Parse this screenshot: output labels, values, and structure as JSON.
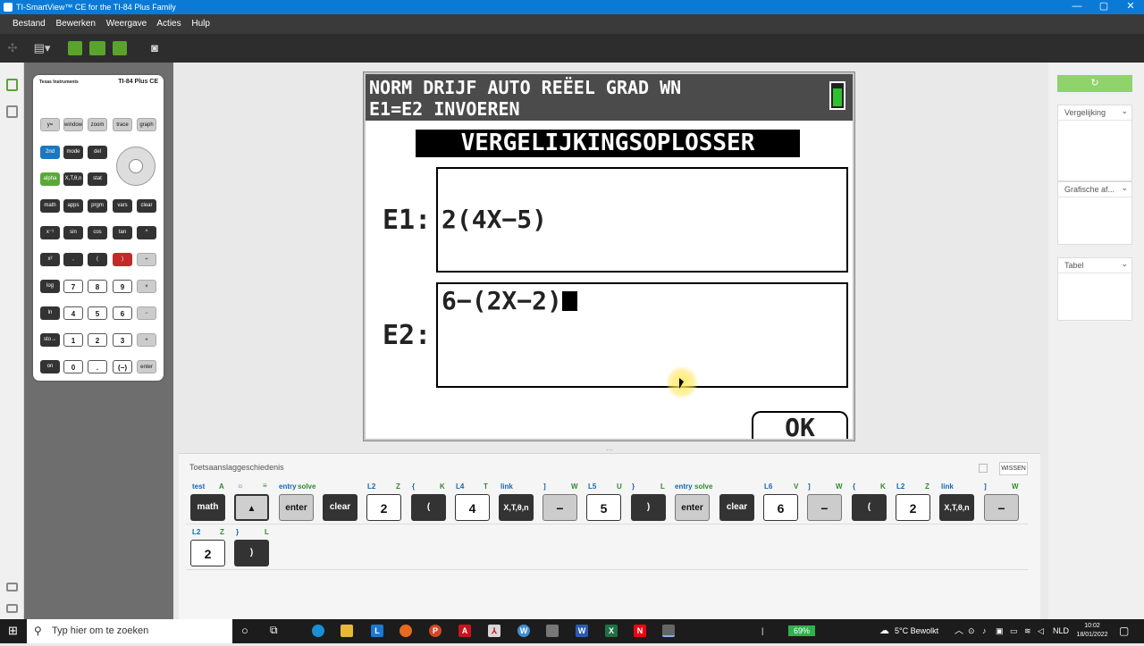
{
  "window": {
    "title": "TI-SmartView™ CE for the TI-84 Plus Family",
    "controls": [
      "—",
      "▢",
      "✕"
    ]
  },
  "menu": [
    "Bestand",
    "Bewerken",
    "Weergave",
    "Acties",
    "Hulp"
  ],
  "calculator": {
    "brand": "Texas Instruments",
    "model": "TI-84 Plus CE",
    "keys": {
      "y": "y=",
      "window": "window",
      "zoom": "zoom",
      "trace": "trace",
      "graph": "graph",
      "second": "2nd",
      "mode": "mode",
      "del": "del",
      "alpha": "alpha",
      "xt": "X,T,θ,n",
      "stat": "stat",
      "math": "math",
      "apps": "apps",
      "prgm": "prgm",
      "vars": "vars",
      "clear": "clear",
      "inv": "x⁻¹",
      "sin": "sin",
      "cos": "cos",
      "tan": "tan",
      "pow": "^",
      "sq": "x²",
      "comma": ",",
      "lp": "(",
      "rp": ")",
      "div": "÷",
      "log": "log",
      "k7": "7",
      "k8": "8",
      "k9": "9",
      "mul": "×",
      "ln": "ln",
      "k4": "4",
      "k5": "5",
      "k6": "6",
      "sub": "−",
      "sto": "sto→",
      "k1": "1",
      "k2": "2",
      "k3": "3",
      "add": "+",
      "on": "on",
      "k0": "0",
      "dot": ".",
      "neg": "(−)",
      "enter": "enter"
    }
  },
  "lcd": {
    "status_line1": "NORM DRIJF AUTO REËEL GRAD WN",
    "status_line2": "E1=E2 INVOEREN",
    "title": "VERGELIJKINGSOPLOSSER",
    "e1_label": "E1:",
    "e1_value": "2(4X−5)",
    "e2_label": "E2:",
    "e2_value": "6−(2X−2)",
    "ok": "OK"
  },
  "history": {
    "title": "Toetsaanslaggeschiedenis",
    "clear_label": "WISSEN",
    "row1": [
      {
        "top_left": "test",
        "top_right": "A",
        "label": "math"
      },
      {
        "top_left": "☼",
        "top_right": "≡",
        "label": "▲"
      },
      {
        "top_left": "entry",
        "top_right": "solve",
        "label": "enter"
      },
      {
        "top_left": "",
        "top_right": "",
        "label": "clear"
      },
      {
        "top_left": "L2",
        "top_right": "Z",
        "label": "2"
      },
      {
        "top_left": "{",
        "top_right": "K",
        "label": "("
      },
      {
        "top_left": "L4",
        "top_right": "T",
        "label": "4"
      },
      {
        "top_left": "link",
        "top_right": "",
        "label": "X,T,θ,n"
      },
      {
        "top_left": "]",
        "top_right": "W",
        "label": "−"
      },
      {
        "top_left": "L5",
        "top_right": "U",
        "label": "5"
      },
      {
        "top_left": "}",
        "top_right": "L",
        "label": ")"
      },
      {
        "top_left": "entry",
        "top_right": "solve",
        "label": "enter"
      },
      {
        "top_left": "",
        "top_right": "",
        "label": "clear"
      },
      {
        "top_left": "L6",
        "top_right": "V",
        "label": "6"
      },
      {
        "top_left": "]",
        "top_right": "W",
        "label": "−"
      },
      {
        "top_left": "{",
        "top_right": "K",
        "label": "("
      },
      {
        "top_left": "L2",
        "top_right": "Z",
        "label": "2"
      },
      {
        "top_left": "link",
        "top_right": "",
        "label": "X,T,θ,n"
      },
      {
        "top_left": "]",
        "top_right": "W",
        "label": "−"
      }
    ],
    "row2": [
      {
        "top_left": "L2",
        "top_right": "Z",
        "label": "2"
      },
      {
        "top_left": "}",
        "top_right": "L",
        "label": ")"
      }
    ]
  },
  "right_panel": {
    "refresh": "↻",
    "sections": [
      "Vergelijking",
      "Grafische af...",
      "Tabel"
    ]
  },
  "taskbar": {
    "search_placeholder": "Typ hier om te zoeken",
    "battery": "69%",
    "weather": "5°C  Bewolkt",
    "lang": "NLD",
    "time": "10:02",
    "date": "18/01/2022"
  }
}
